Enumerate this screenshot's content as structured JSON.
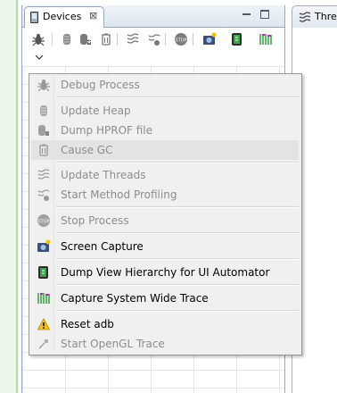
{
  "devices_view": {
    "tab_title": "Devices",
    "close_glyph": "⊠",
    "toolbar_icons": [
      "debug-icon",
      "update-heap-icon",
      "dump-hprof-icon",
      "cause-gc-icon",
      "update-threads-icon",
      "method-profiling-icon",
      "stop-process-icon",
      "screen-capture-icon",
      "dump-view-hierarchy-icon",
      "systrace-icon"
    ],
    "menu_chevron": "chevron-down-icon"
  },
  "right_view": {
    "tab_title": "Thre"
  },
  "menu": {
    "items": [
      {
        "label": "Debug Process",
        "icon": "debug-icon",
        "enabled": false
      },
      {
        "label": "Update Heap",
        "icon": "update-heap-icon",
        "enabled": false
      },
      {
        "label": "Dump HPROF file",
        "icon": "dump-hprof-icon",
        "enabled": false
      },
      {
        "label": "Cause GC",
        "icon": "cause-gc-icon",
        "enabled": false,
        "highlighted": true
      },
      {
        "label": "Update Threads",
        "icon": "update-threads-icon",
        "enabled": false
      },
      {
        "label": "Start Method Profiling",
        "icon": "method-profiling-icon",
        "enabled": false
      },
      {
        "label": "Stop Process",
        "icon": "stop-process-icon",
        "enabled": false
      },
      {
        "label": "Screen Capture",
        "icon": "screen-capture-icon",
        "enabled": true
      },
      {
        "label": "Dump View Hierarchy for UI Automator",
        "icon": "dump-view-hierarchy-icon",
        "enabled": true
      },
      {
        "label": "Capture System Wide Trace",
        "icon": "systrace-icon",
        "enabled": true
      },
      {
        "label": "Reset adb",
        "icon": "warning-icon",
        "enabled": true
      },
      {
        "label": "Start OpenGL Trace",
        "icon": "opengl-trace-icon",
        "enabled": false
      }
    ]
  },
  "colors": {
    "disabled_text": "#8d8d8d",
    "menu_bg": "#f0f0f0",
    "highlight": "#e3e3e3",
    "tab_border": "#9aa7b5"
  }
}
